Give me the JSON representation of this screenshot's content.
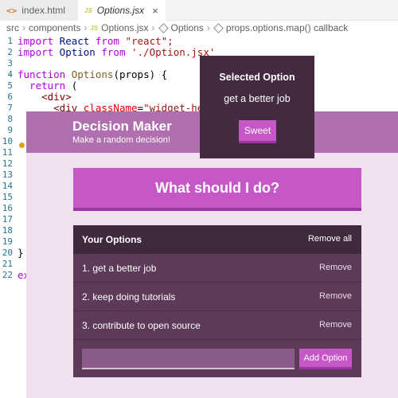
{
  "editor": {
    "tabs": [
      {
        "label": "index.html",
        "icon": "html-file-icon"
      },
      {
        "label": "Options.jsx",
        "icon": "js-file-icon",
        "close": "×"
      }
    ],
    "breadcrumb": [
      "src",
      "components",
      "Options.jsx",
      "Options",
      "props.options.map() callback"
    ],
    "line_numbers": [
      "1",
      "2",
      "3",
      "4",
      "5",
      "6",
      "7",
      "8",
      "9",
      "10",
      "11",
      "12",
      "13",
      "14",
      "15",
      "16",
      "17",
      "18",
      "19",
      "20",
      "21",
      "22"
    ],
    "code": {
      "l1_import": "import",
      "l1_react": " React ",
      "l1_from": "from",
      "l1_str": " \"react\";",
      "l2_import": "import",
      "l2_option": " Option ",
      "l2_from": "from",
      "l2_str": " './Option.jsx'",
      "l4_function": "function",
      "l4_name": " Options",
      "l4_args": "(props) {",
      "l5_return": "  return",
      "l5_paren": " (",
      "l6_div": "    <div>",
      "l7_open": "      <div ",
      "l7_attr": "className",
      "l7_eq": "=",
      "l7_str": "\"widget-header",
      "l20": "}",
      "l22": "ex"
    }
  },
  "app": {
    "header": {
      "title": "Decision Maker",
      "subtitle": "Make a random decision!"
    },
    "action_button": "What should I do?",
    "options": {
      "title": "Your Options",
      "remove_all": "Remove all",
      "items": [
        {
          "text": "1. get a better job",
          "remove": "Remove"
        },
        {
          "text": "2. keep doing tutorials",
          "remove": "Remove"
        },
        {
          "text": "3. contribute to open source",
          "remove": "Remove"
        }
      ],
      "input_value": "",
      "add_button": "Add Option"
    },
    "modal": {
      "title": "Selected Option",
      "text": "get a better job",
      "button": "Sweet"
    }
  },
  "colors": {
    "header": "#b06fae",
    "accent": "#c558c6",
    "widget": "#5c3a58",
    "modal": "#432a40",
    "background": "#f1e0ef"
  }
}
